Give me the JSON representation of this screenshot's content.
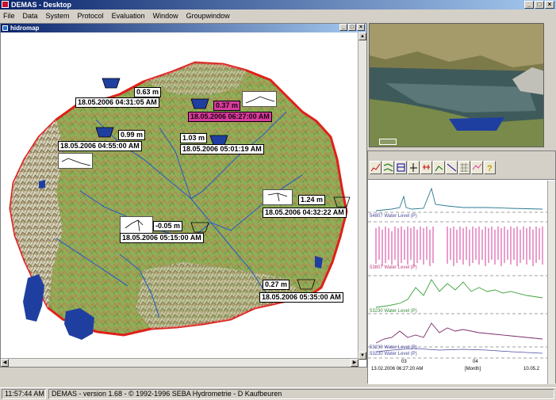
{
  "app": {
    "title": "DEMAS - Desktop",
    "menu": [
      "File",
      "Data",
      "System",
      "Protocol",
      "Evaluation",
      "Window",
      "Groupwindow"
    ]
  },
  "map_window": {
    "title": "hidromap",
    "stations": [
      {
        "value": "0.63 m",
        "time": "18.05.2006 04:31:05 AM"
      },
      {
        "value": "0.37 m",
        "time": "18.05.2006 06:27:00 AM",
        "alarm": true
      },
      {
        "value": "0.99 m",
        "time": "18.05.2006 04:55:00 AM"
      },
      {
        "value": "1.03 m",
        "time": "18.05.2006 05:01:19 AM"
      },
      {
        "value": "1.24 m",
        "time": "18.05.2006 04:32:22 AM"
      },
      {
        "value": "-0.05 m",
        "time": "18.05.2006 05:15:00 AM"
      },
      {
        "value": "0.27 m",
        "time": "18.05.2006 05:35:00 AM"
      }
    ]
  },
  "chart_window": {
    "series_labels": [
      "54807 Water Level (P)",
      "53807 Water Level (P)",
      "53230 Water Level (P)",
      "53230 Water Level (P)",
      "53230 Water Level (P)"
    ],
    "x_ticks": [
      "03",
      "04"
    ],
    "x_unit": "[Month]",
    "start_time": "13.02.2006 06:27:20 AM",
    "end_time": "10.05.2"
  },
  "statusbar": {
    "time": "11:57:44 AM",
    "text": "DEMAS - version 1.68 - © 1992-1996 SEBA Hydrometrie - D Kaufbeuren"
  },
  "colors": {
    "titlebar": "#0a246a",
    "alarm": "#d63c9c",
    "border": "#e0201a",
    "water": "#1f3fa0"
  }
}
